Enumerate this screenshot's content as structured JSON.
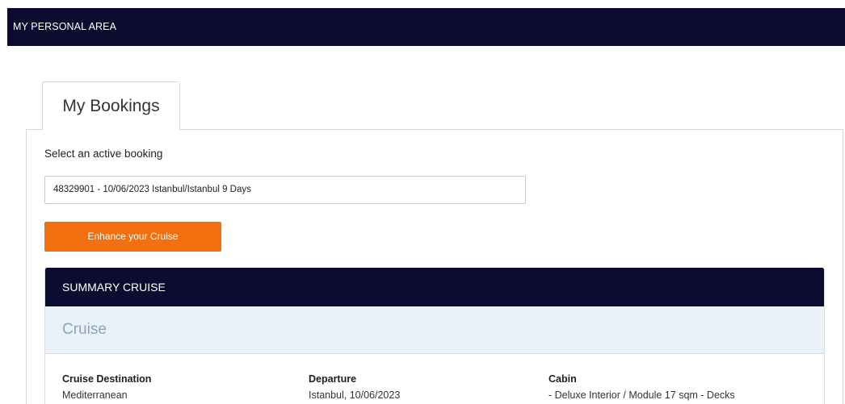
{
  "header": {
    "title": "MY PERSONAL AREA"
  },
  "tabs": [
    {
      "label": "My Bookings"
    }
  ],
  "booking": {
    "select_label": "Select an active booking",
    "selected_value": "48329901 - 10/06/2023 Istanbul/Istanbul 9 Days",
    "enhance_button": "Enhance your Cruise"
  },
  "summary": {
    "title": "SUMMARY CRUISE",
    "section_title": "Cruise",
    "fields": [
      {
        "label": "Cruise Destination",
        "value": "Mediterranean"
      },
      {
        "label": "Departure",
        "value": "Istanbul, 10/06/2023"
      },
      {
        "label": "Cabin",
        "value": "- Deluxe Interior / Module 17 sqm - Decks"
      }
    ]
  },
  "colors": {
    "header_bg": "#0c0c30",
    "accent_orange": "#f2700f",
    "cruise_bar_bg": "#eaf1f8",
    "cruise_title": "#8aa5b8"
  }
}
